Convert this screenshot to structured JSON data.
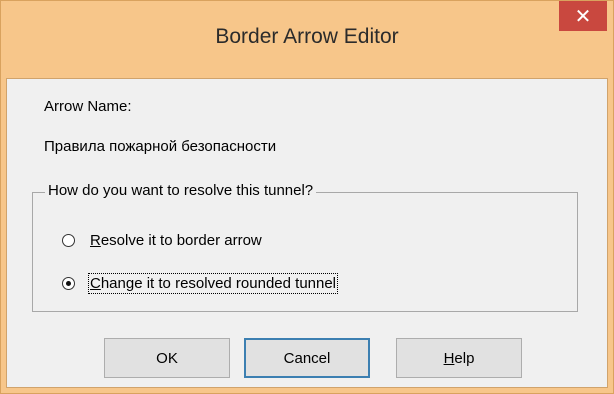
{
  "window": {
    "title": "Border Arrow Editor",
    "close_icon": "close-icon"
  },
  "arrow": {
    "name_label": "Arrow Name:",
    "name_value": "Правила пожарной безопасности"
  },
  "resolve_group": {
    "legend": "How do you want to resolve this tunnel?",
    "options": [
      {
        "mnemonic": "R",
        "rest": "esolve it to border arrow",
        "checked": false
      },
      {
        "mnemonic": "C",
        "rest": "hange it to resolved rounded tunnel",
        "checked": true
      }
    ]
  },
  "buttons": {
    "ok": "OK",
    "cancel": "Cancel",
    "help_mnemonic": "H",
    "help_rest": "elp"
  },
  "colors": {
    "titlebar": "#f7c68a",
    "close_button": "#c9483f",
    "client_bg": "#f0f0f0"
  }
}
